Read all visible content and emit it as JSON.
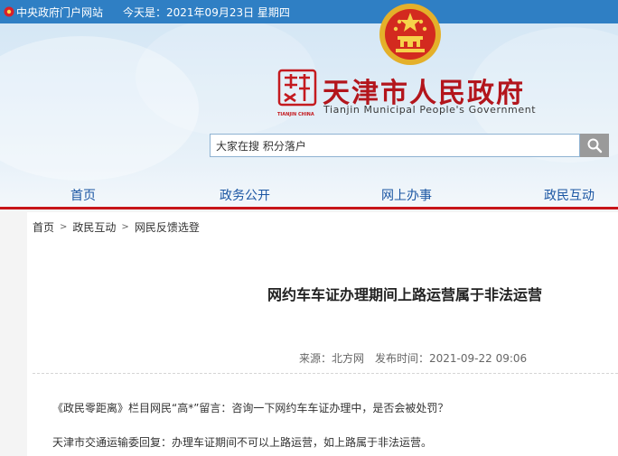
{
  "topbar": {
    "home_link": "中央政府门户网站",
    "date_text": "今天是：2021年09月23日 星期四"
  },
  "header": {
    "title_zh": "天津市人民政府",
    "title_en": "Tianjin Municipal People's Government",
    "logo_caption": "TIANJIN CHINA",
    "search_value": "大家在搜 积分落户"
  },
  "nav": {
    "items": [
      "首页",
      "政务公开",
      "网上办事",
      "政民互动"
    ]
  },
  "breadcrumb": {
    "items": [
      "首页",
      "政民互动",
      "网民反馈选登"
    ]
  },
  "article": {
    "title": "网约车车证办理期间上路运营属于非法运营",
    "source": "来源：北方网",
    "publish_time": "发布时间：2021-09-22 09:06",
    "paragraphs": [
      "《政民零距离》栏目网民“高*”留言：咨询一下网约车车证办理中，是否会被处罚？",
      "天津市交通运输委回复：办理车证期间不可以上路运营，如上路属于非法运营。"
    ]
  },
  "colors": {
    "topbar_bg": "#2f7fc4",
    "title_red": "#b3151c",
    "nav_blue": "#1b56a3",
    "accent_line": "#c7141a"
  },
  "icons": {
    "home": "home-icon",
    "emblem": "national-emblem-icon",
    "search": "search-icon",
    "breadcrumb_sep": "chevron-right-icon"
  }
}
